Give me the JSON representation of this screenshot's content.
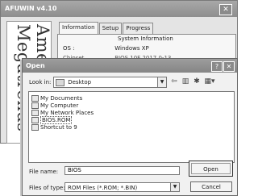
{
  "background_window": {
    "title": "AFUWIN v4.10",
    "close_glyph": "✕",
    "banner_text": "American Megatrends",
    "tabs": [
      "Information",
      "Setup",
      "Progress"
    ],
    "group_title": "System Information",
    "os_label": "OS :",
    "os_value": "Windows XP",
    "bios_label": "Chipset",
    "bios_value": "BIOS 10F 2017 0-13"
  },
  "open_dialog": {
    "title": "Open",
    "help_glyph": "?",
    "close_glyph": "✕",
    "look_in_label": "Look in:",
    "look_in_value": "Desktop",
    "dropdown_glyph": "▼",
    "toolbar": {
      "back_glyph": "⇦",
      "up_glyph": "▥",
      "new_folder_glyph": "✱",
      "view_glyph": "▦▾"
    },
    "files": [
      {
        "label": "My Documents",
        "icon": "documents-folder-icon"
      },
      {
        "label": "My Computer",
        "icon": "computer-icon"
      },
      {
        "label": "My Network Places",
        "icon": "network-places-icon"
      },
      {
        "label": "BIOS.ROM",
        "icon": "rom-file-icon",
        "selected": true
      },
      {
        "label": "Shortcut to 9",
        "icon": "shortcut-icon"
      }
    ],
    "file_name_label": "File name:",
    "file_name_value": "BIOS",
    "files_of_type_label": "Files of type:",
    "files_of_type_value": "ROM Files (*.ROM; *.BIN)",
    "open_button": "Open",
    "cancel_button": "Cancel"
  }
}
